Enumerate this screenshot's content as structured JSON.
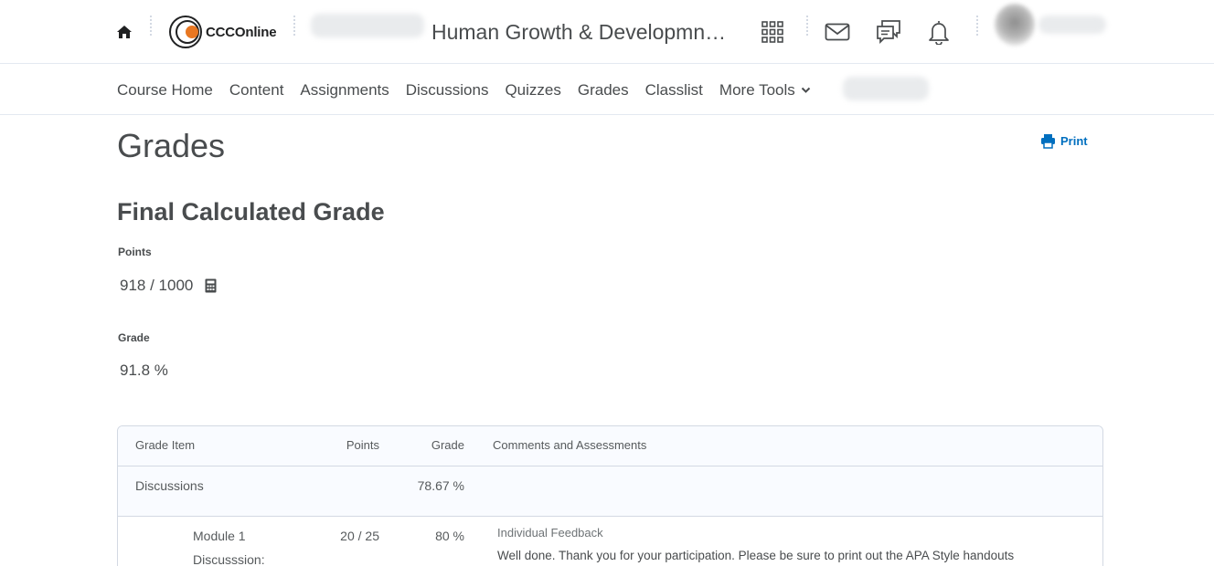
{
  "header": {
    "logo_text": "CCCOnline",
    "course_title": "Human Growth & Developmn…",
    "icons": [
      "home-icon",
      "waffle-grid-icon",
      "mail-icon",
      "chat-icon",
      "bell-icon"
    ]
  },
  "nav": {
    "items": [
      "Course Home",
      "Content",
      "Assignments",
      "Discussions",
      "Quizzes",
      "Grades",
      "Classlist"
    ],
    "more_label": "More Tools"
  },
  "page": {
    "title": "Grades",
    "print_label": "Print"
  },
  "final_grade": {
    "heading": "Final Calculated Grade",
    "points_label": "Points",
    "points_value": "918 / 1000",
    "grade_label": "Grade",
    "grade_value": "91.8 %"
  },
  "table": {
    "columns": {
      "item": "Grade Item",
      "points": "Points",
      "grade": "Grade",
      "comments": "Comments and Assessments"
    },
    "category": {
      "name": "Discussions",
      "grade": "78.67 %"
    },
    "item": {
      "name_line1": "Module 1",
      "name_line2": "Discusssion:",
      "points": "20 / 25",
      "grade": "80 %",
      "feedback_label": "Individual Feedback",
      "feedback_text": "Well done. Thank you for your participation. Please be sure to print out the APA Style handouts"
    }
  },
  "colors": {
    "accent_blue": "#006fbf",
    "text": "#494c4e",
    "logo_orange": "#e87722",
    "border": "#d3d9e3"
  }
}
